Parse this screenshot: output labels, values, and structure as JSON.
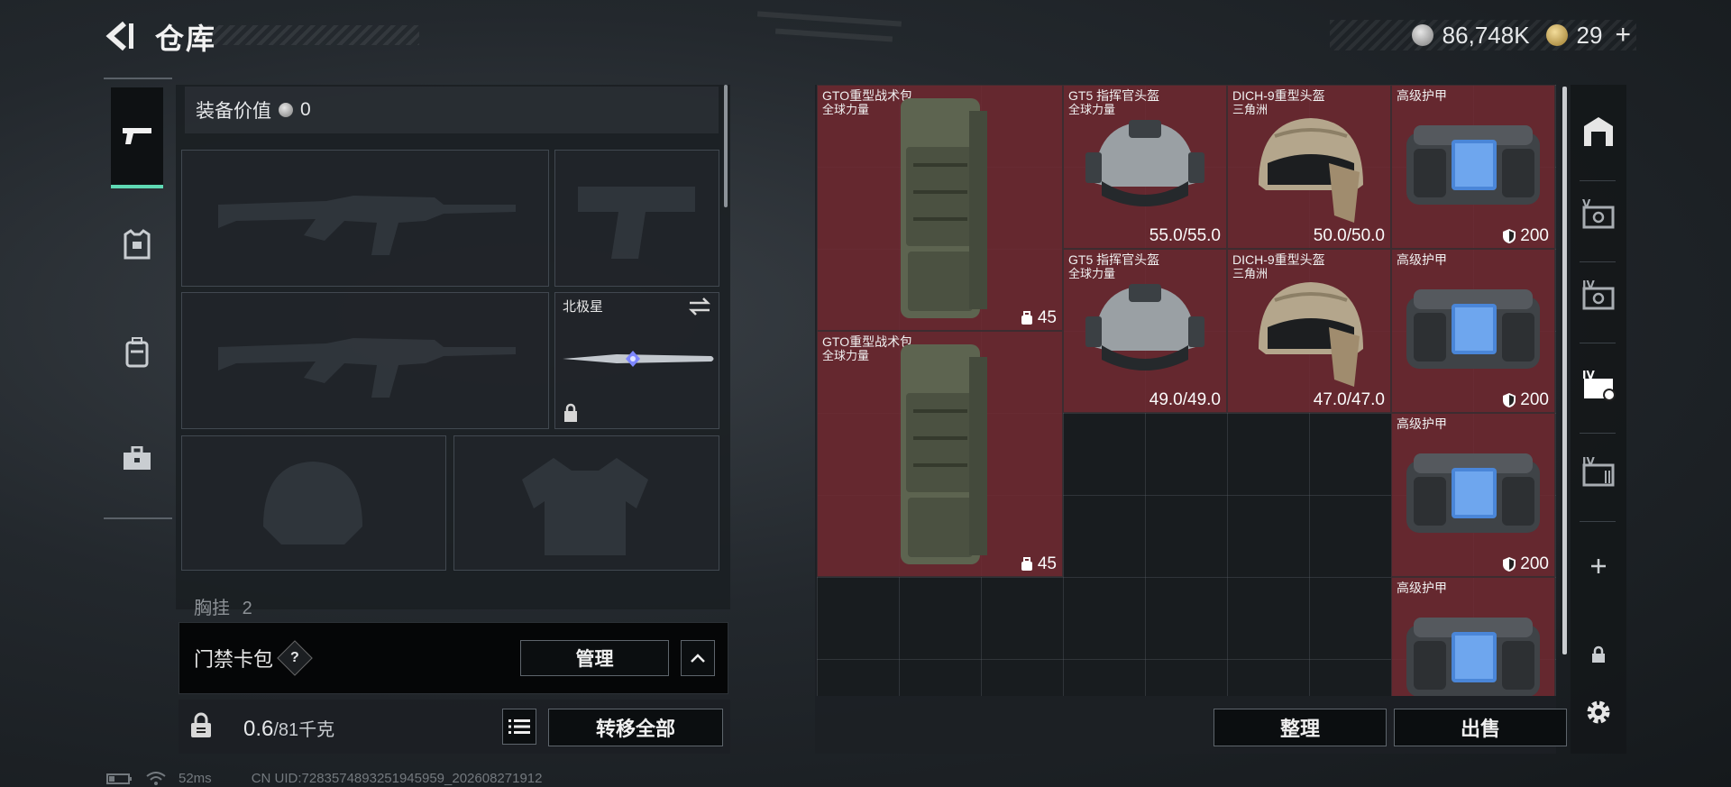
{
  "header": {
    "title": "仓库"
  },
  "currency": {
    "silver": "86,748K",
    "gold": "29"
  },
  "loadout": {
    "equip_value_label": "装备价值",
    "equip_value": "0",
    "melee_slot_label": "北极星",
    "chest_label": "胸挂",
    "chest_count": "2"
  },
  "keycard": {
    "title": "门禁卡包",
    "help": "?",
    "manage_label": "管理"
  },
  "capacity": {
    "current": "0.6",
    "max": "/81千克"
  },
  "buttons": {
    "transfer_all": "转移全部",
    "organize": "整理",
    "sell": "出售"
  },
  "stash": {
    "items": [
      {
        "name": "GTO重型战术包",
        "sub": "全球力量",
        "value": "45",
        "kind": "backpack"
      },
      {
        "name": "GT5 指挥官头盔",
        "sub": "全球力量",
        "value": "55.0/55.0",
        "kind": "helmet-gt5"
      },
      {
        "name": "DICH-9重型头盔",
        "sub": "三角洲",
        "value": "50.0/50.0",
        "kind": "helmet-dich"
      },
      {
        "name": "高级护甲",
        "sub": "",
        "value": "200",
        "kind": "armor"
      },
      {
        "name": "GT5 指挥官头盔",
        "sub": "全球力量",
        "value": "49.0/49.0",
        "kind": "helmet-gt5"
      },
      {
        "name": "DICH-9重型头盔",
        "sub": "三角洲",
        "value": "47.0/47.0",
        "kind": "helmet-dich"
      },
      {
        "name": "高级护甲",
        "sub": "",
        "value": "200",
        "kind": "armor"
      },
      {
        "name": "GTO重型战术包",
        "sub": "全球力量",
        "value": "45",
        "kind": "backpack"
      },
      {
        "name": "高级护甲",
        "sub": "",
        "value": "200",
        "kind": "armor"
      },
      {
        "name": "高级护甲",
        "sub": "",
        "value": "",
        "kind": "armor"
      }
    ]
  },
  "footer": {
    "ping": "52ms",
    "uid": "CN UID:7283574893251945959_202608271912"
  },
  "colors": {
    "accent": "#5fd9b4",
    "item_bg": "#702a32"
  }
}
